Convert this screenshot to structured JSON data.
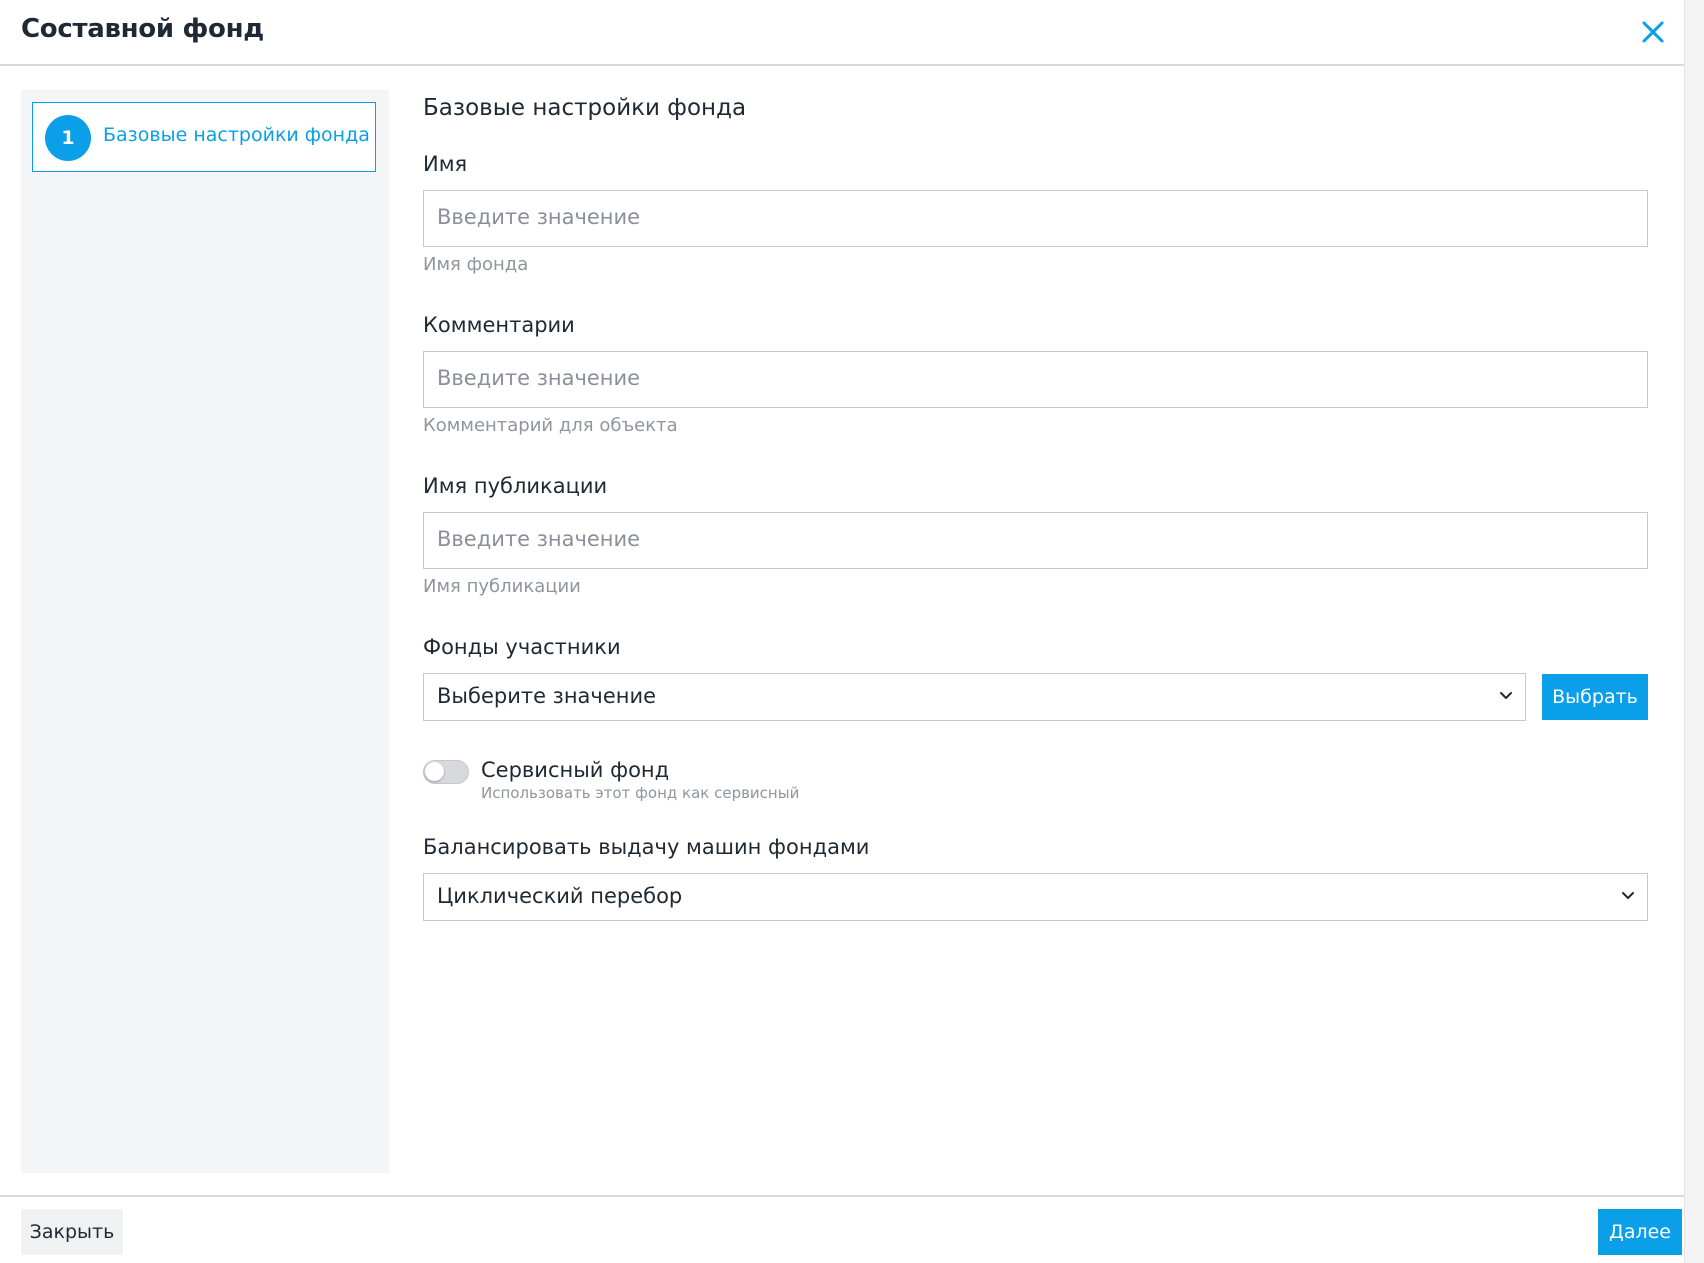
{
  "dialog": {
    "title": "Составной фонд",
    "close_icon": "close-icon"
  },
  "sidebar": {
    "steps": [
      {
        "number": "1",
        "label": "Базовые настройки фонда",
        "active": true
      }
    ]
  },
  "form": {
    "section_title": "Базовые настройки фонда",
    "name": {
      "label": "Имя",
      "placeholder": "Введите значение",
      "hint": "Имя фонда"
    },
    "comments": {
      "label": "Комментарии",
      "placeholder": "Введите значение",
      "hint": "Комментарий для объекта"
    },
    "publication_name": {
      "label": "Имя публикации",
      "placeholder": "Введите значение",
      "hint": "Имя публикации"
    },
    "member_pools": {
      "label": "Фонды участники",
      "selected": "Выберите значение",
      "button_label": "Выбрать"
    },
    "service_pool": {
      "label": "Сервисный фонд",
      "description": "Использовать этот фонд как сервисный",
      "enabled": false
    },
    "balancing": {
      "label": "Балансировать выдачу машин фондами",
      "selected": "Циклический перебор"
    }
  },
  "footer": {
    "close_label": "Закрыть",
    "next_label": "Далее"
  },
  "colors": {
    "accent": "#0a9fe8",
    "border": "#c7c9cc",
    "sidebar_bg": "#f4f5f6"
  }
}
